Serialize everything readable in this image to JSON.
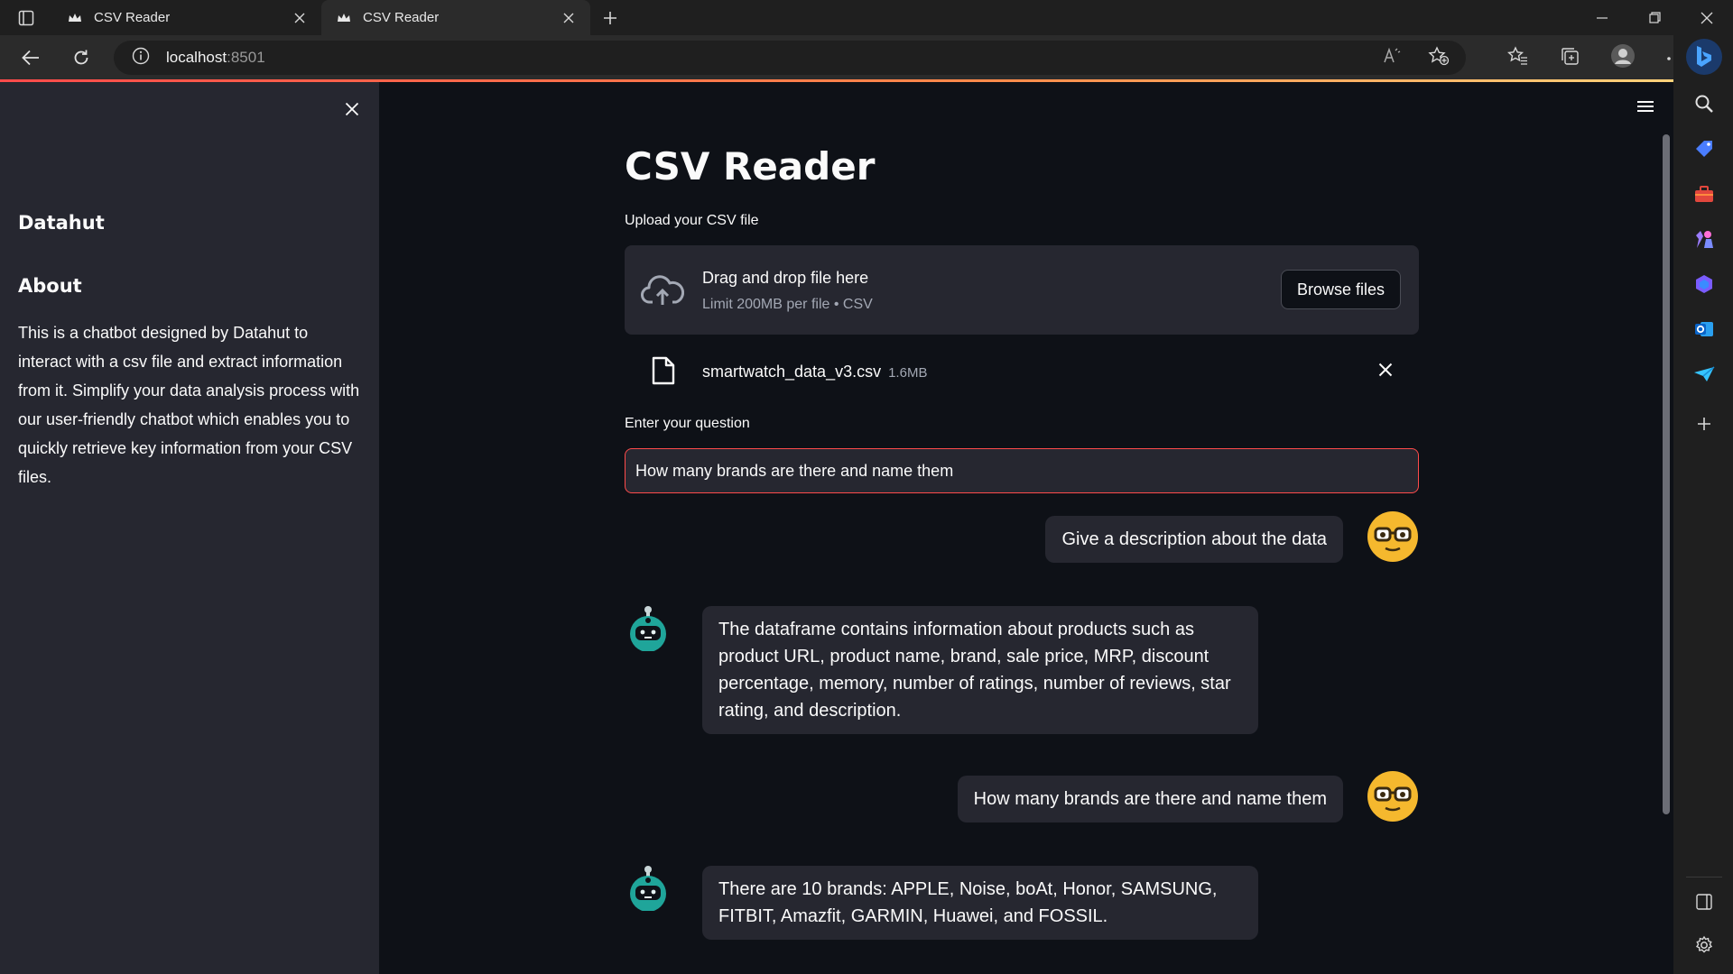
{
  "browser": {
    "tabs": [
      {
        "title": "CSV Reader",
        "active": false
      },
      {
        "title": "CSV Reader",
        "active": true
      }
    ],
    "url_host": "localhost",
    "url_port": ":8501"
  },
  "sidebar": {
    "brand": "Datahut",
    "about_heading": "About",
    "about_text": "This is a chatbot designed by Datahut to interact with a csv file and extract information from it. Simplify your data analysis process with our user-friendly chatbot which enables you to quickly retrieve key information from your CSV files."
  },
  "main": {
    "title": "CSV Reader",
    "upload_label": "Upload your CSV file",
    "dropzone_text": "Drag and drop file here",
    "dropzone_limit": "Limit 200MB per file • CSV",
    "browse_label": "Browse files",
    "file_name": "smartwatch_data_v3.csv",
    "file_size": "1.6MB",
    "question_label": "Enter your question",
    "question_value": "How many brands are there and name them"
  },
  "chat": [
    {
      "role": "user",
      "text": "Give a description about the data"
    },
    {
      "role": "bot",
      "text": "The dataframe contains information about products such as product URL, product name, brand, sale price, MRP, discount percentage, memory, number of ratings, number of reviews, star rating, and description."
    },
    {
      "role": "user",
      "text": "How many brands are there and name them"
    },
    {
      "role": "bot",
      "text": "There are 10 brands: APPLE, Noise, boAt, Honor, SAMSUNG, FITBIT, Amazfit, GARMIN, Huawei, and FOSSIL."
    }
  ],
  "colors": {
    "accent": "#ff4b4b",
    "app_bg": "#0e1117",
    "panel_bg": "#262730",
    "user_avatar": "#f5b82e",
    "bot_avatar": "#1fa59a"
  },
  "icons": [
    "tab-actions-icon",
    "crown-favicon-icon",
    "close-icon",
    "plus-icon",
    "minimize-icon",
    "restore-icon",
    "back-icon",
    "refresh-icon",
    "info-icon",
    "read-aloud-icon",
    "favorite-add-icon",
    "favorites-icon",
    "collections-icon",
    "profile-icon",
    "more-icon",
    "bing-icon",
    "search-icon",
    "shopping-icon",
    "tools-icon",
    "games-icon",
    "office-icon",
    "outlook-icon",
    "send-icon",
    "split-screen-icon",
    "settings-icon",
    "hamburger-icon",
    "cloud-upload-icon",
    "file-icon"
  ]
}
